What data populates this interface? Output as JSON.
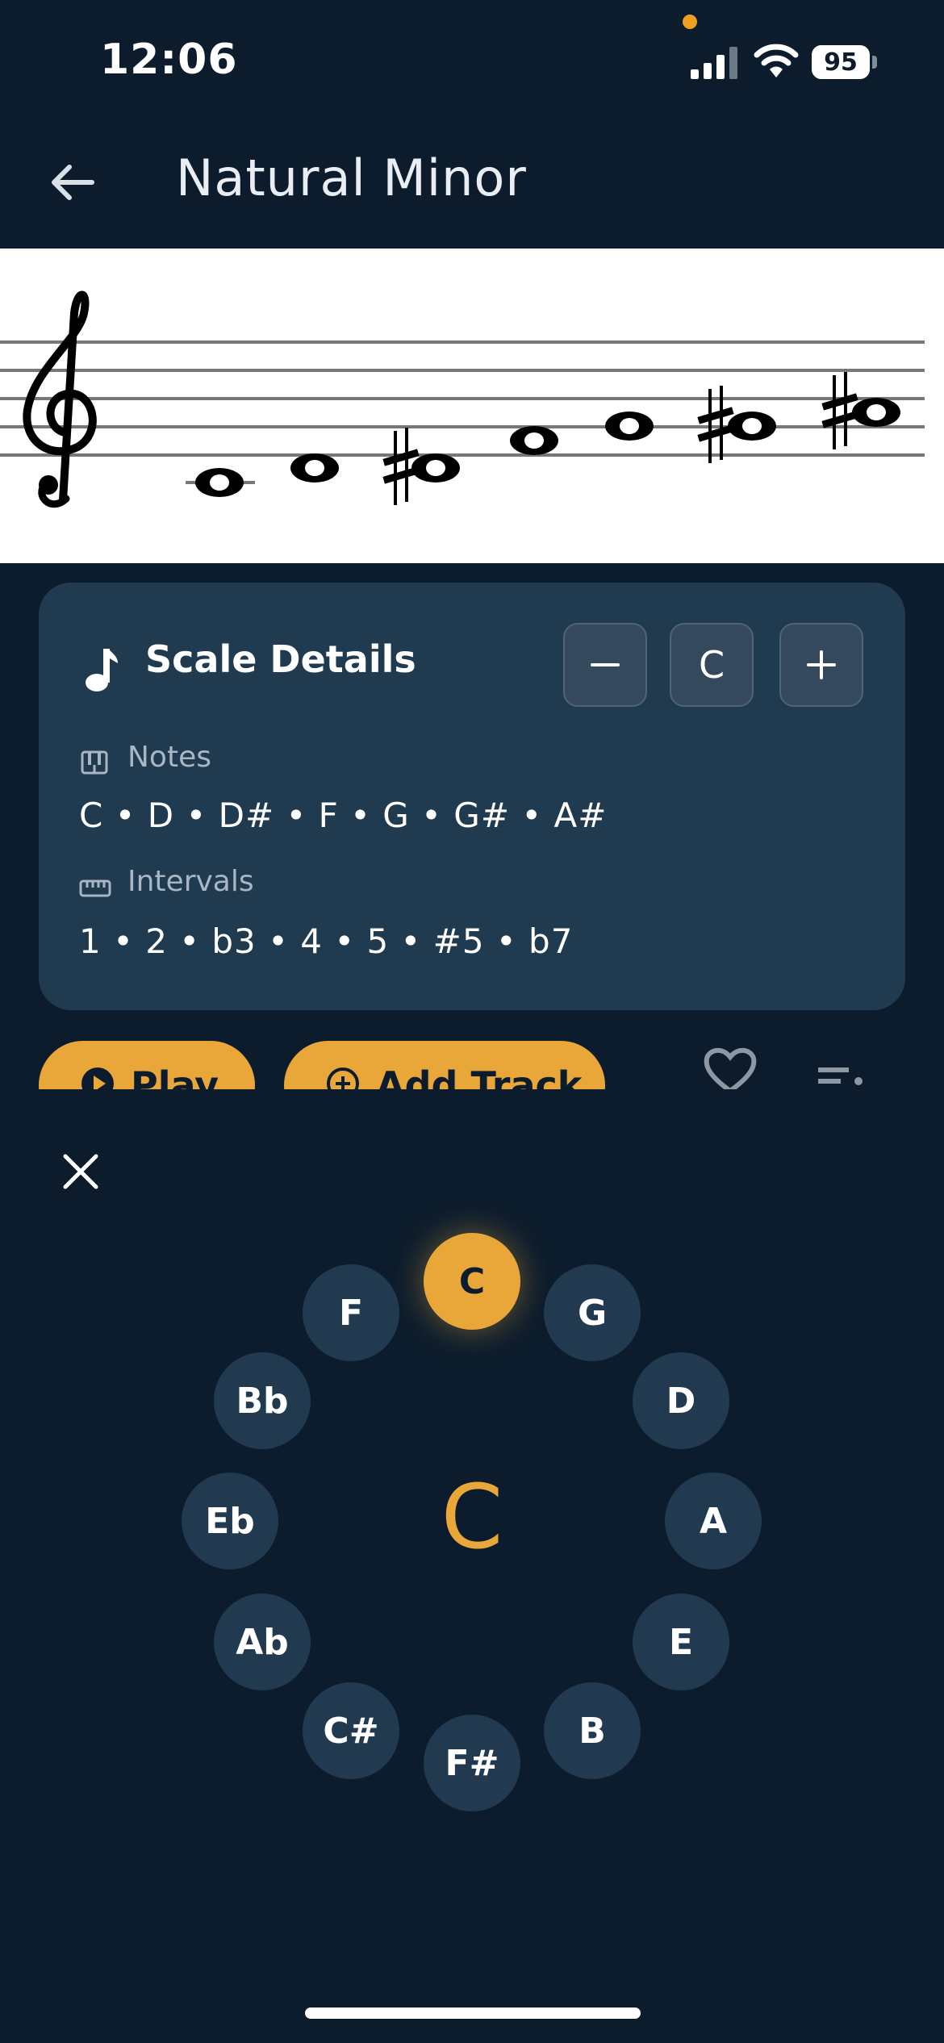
{
  "status_bar": {
    "time": "12:06",
    "battery": "95"
  },
  "nav": {
    "title": "Natural Minor"
  },
  "details": {
    "title": "Scale Details",
    "key_minus_label": "−",
    "key": "C",
    "key_plus_label": "+",
    "notes_label": "Notes",
    "notes": "C • D • D# • F • G • G# • A#",
    "intervals_label": "Intervals",
    "intervals": "1 • 2 • b3 • 4 • 5 • #5 • b7"
  },
  "actions": {
    "play_label": "Play",
    "add_track_label": "Add Track"
  },
  "key_picker": {
    "selected": "C",
    "center_label": "C",
    "keys": [
      "C",
      "G",
      "D",
      "A",
      "E",
      "B",
      "F#",
      "C#",
      "Ab",
      "Eb",
      "Bb",
      "F"
    ]
  },
  "colors": {
    "accent": "#e9a73a",
    "background": "#0c1c2c",
    "card": "#203a50"
  }
}
